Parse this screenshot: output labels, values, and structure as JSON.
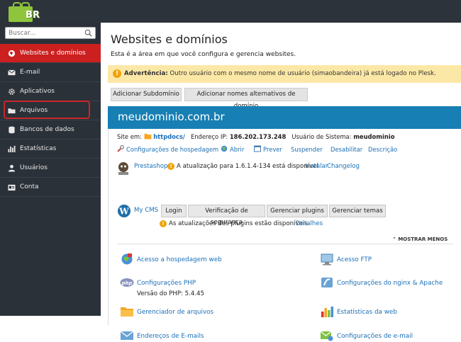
{
  "logo": {
    "text": "BR",
    "text2": "",
    "text3": ""
  },
  "search": {
    "placeholder": "Buscar..."
  },
  "nav": [
    {
      "label": "Websites e domínios",
      "icon": "globe-icon"
    },
    {
      "label": "E-mail",
      "icon": "envelope-icon"
    },
    {
      "label": "Aplicativos",
      "icon": "gear-icon"
    },
    {
      "label": "Arquivos",
      "icon": "folder-icon"
    },
    {
      "label": "Bancos de dados",
      "icon": "database-icon"
    },
    {
      "label": "Estatísticas",
      "icon": "bar-chart-icon"
    },
    {
      "label": "Usuários",
      "icon": "user-icon"
    },
    {
      "label": "Conta",
      "icon": "account-icon"
    }
  ],
  "page": {
    "title": "Websites e domínios",
    "subtitle": "Esta é a área em que você configura e gerencia websites."
  },
  "warning": {
    "label": "Advertência:",
    "text": "Outro usuário com o mesmo nome de usuário (simaobandeira) já está logado no Plesk."
  },
  "buttons": {
    "add_subdomain": "Adicionar Subdomínio",
    "add_alias": "Adicionar nomes alternativos de domínio"
  },
  "domain": {
    "name": "meudominio.com.br",
    "site_label": "Site em:",
    "site_folder": "httpdocs/",
    "ip_label": "Endereço IP:",
    "ip": "186.202.173.248",
    "sysuser_label": "Usuário de Sistema:",
    "sysuser": "meudominio"
  },
  "actions": [
    "Configurações de hospedagem",
    "Abrir",
    "Prever",
    "Suspender",
    "Desabilitar",
    "Descrição"
  ],
  "prestashop": {
    "name": "Prestashop",
    "update_text": "A atualização para 1.6.1.4-134 está disponível",
    "install": "Instalar",
    "changelog": "Changelog"
  },
  "mycms": {
    "label": "My CMS",
    "buttons": [
      "Login",
      "Verificação de segurança",
      "Gerenciar plugins",
      "Gerenciar temas"
    ],
    "plugin_warning": "As atualizações dos plugins estão disponíveis.",
    "details": "Detalhes"
  },
  "show_less": "MOSTRAR MENOS",
  "quick": [
    {
      "label": "Acesso a hospedagem web",
      "icon": "hosting-access-icon"
    },
    {
      "label": "Acesso FTP",
      "icon": "ftp-icon"
    },
    {
      "label": "Configurações PHP",
      "icon": "php-icon"
    },
    {
      "label": "Configurações do nginx & Apache",
      "icon": "apache-icon"
    },
    {
      "label": "Gerenciador de arquivos",
      "icon": "file-manager-icon"
    },
    {
      "label": "Estatísticas da web",
      "icon": "web-stats-icon"
    },
    {
      "label": "Endereços de E-mails",
      "icon": "email-addresses-icon"
    },
    {
      "label": "Configurações de e-mail",
      "icon": "email-settings-icon"
    }
  ],
  "php_version": "Versão do PHP: 5.4.45",
  "colors": {
    "active": "#cc1f1f",
    "sidebar": "#2b3138",
    "domain_bar": "#177fb4",
    "link": "#1c6fb7",
    "warning_bg": "#fce8a6"
  }
}
